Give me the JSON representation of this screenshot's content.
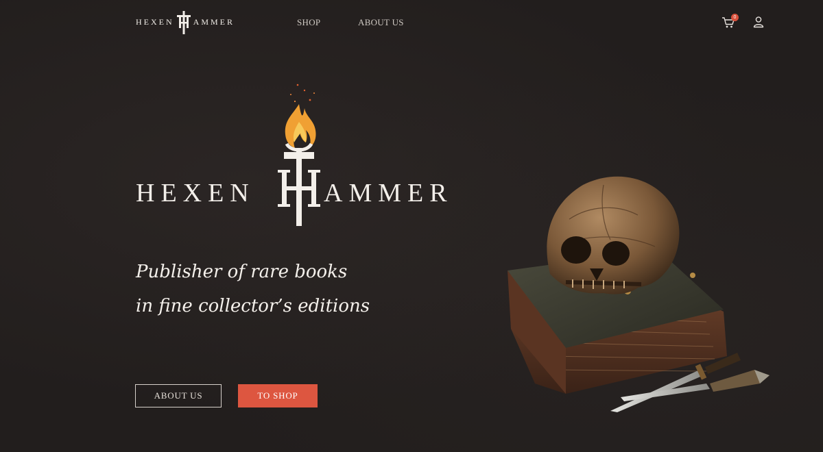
{
  "brand": {
    "left_word": "HEXEN",
    "right_word": "AMMER",
    "logo_icon": "torch-hammer-icon"
  },
  "nav": {
    "shop": "SHOP",
    "about": "ABOUT US"
  },
  "cart": {
    "icon": "cart-icon",
    "count": "0"
  },
  "user": {
    "icon": "user-icon"
  },
  "hero": {
    "tagline_line1": "Publisher of rare books",
    "tagline_line2": "in fine collector’s editions",
    "about_button": "ABOUT US",
    "shop_button": "TO SHOP",
    "illustration": "skull-on-book-with-daggers"
  },
  "colors": {
    "background": "#221e1d",
    "accent": "#dd5640",
    "flame": "#f0a033",
    "text": "#f3efea"
  }
}
